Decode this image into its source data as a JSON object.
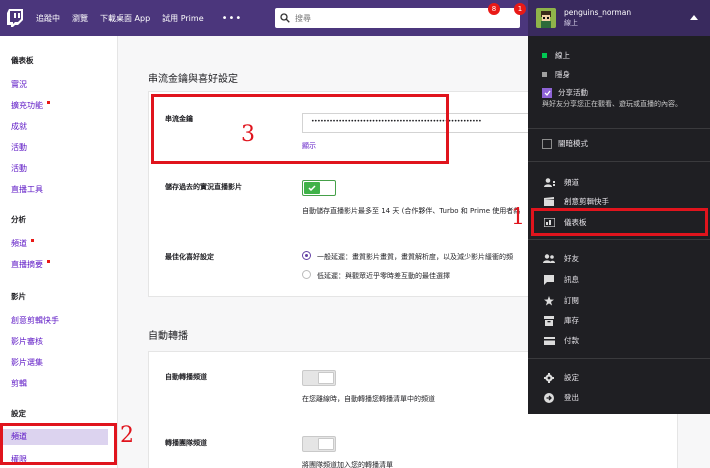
{
  "topnav": {
    "links": [
      "追蹤中",
      "瀏覽",
      "下載桌面 App",
      "試用 Prime"
    ],
    "more": "•••",
    "search_placeholder": "搜尋",
    "crown_badge": "8",
    "bell_badge": "1",
    "username": "penguins_norman",
    "user_status": "線上"
  },
  "sidebar": {
    "dashboard_head": "儀表板",
    "dashboard_items": [
      "實況",
      "擴充功能",
      "成就",
      "活動",
      "活動",
      "直播工具"
    ],
    "analytics_head": "分析",
    "analytics_items": [
      "頻道",
      "直播摘要"
    ],
    "video_head": "影片",
    "video_items": [
      "創意剪輯快手",
      "影片審核",
      "影片選集",
      "剪輯"
    ],
    "settings_head": "設定",
    "settings_items": [
      "頻道",
      "權限"
    ]
  },
  "main": {
    "section1_title": "串流金鑰與喜好設定",
    "stream_key_label": "串流金鑰",
    "stream_key_value": "••••••••••••••••••••••••••••••••••••••••••••••••••••••••",
    "show_link": "顯示",
    "store_label": "儲存過去的實況直播影片",
    "store_desc": "自動儲存直播影片最多至 14 天 (合作夥伴、Turbo 和 Prime 使用者為",
    "latency_label": "最佳化喜好設定",
    "latency_normal": "一般延遲：畫質影片畫質，畫質解析度，以及減少影片緩衝的頻",
    "latency_low": "低延遲：與觀眾近乎零時差互動的最佳選擇",
    "section2_title": "自動轉播",
    "autohost_label": "自動轉播頻道",
    "autohost_desc": "在您離線時，自動轉播您轉播清單中的頻道",
    "team_label": "轉播團隊頻道",
    "team_desc": "將團隊頻道加入您的轉播清單"
  },
  "dropdown": {
    "status_online": "線上",
    "status_hidden": "隱身",
    "share_label": "分享活動",
    "share_desc": "與好友分享您正在觀看、遊玩或直播的內容。",
    "dark_mode": "闇暗模式",
    "channel": "頻道",
    "clips": "創意剪輯快手",
    "dashboard": "儀表板",
    "friends": "好友",
    "messages": "訊息",
    "subscriptions": "訂閱",
    "inventory": "庫存",
    "payments": "付款",
    "settings": "設定",
    "logout": "登出"
  },
  "annotations": {
    "one": "1",
    "two": "2",
    "three": "3"
  },
  "colors": {
    "brand": "#4b367c",
    "accent": "#5c16c5",
    "annotation": "#e0141d",
    "online": "#00c853",
    "toggle_on": "#3fb248"
  }
}
